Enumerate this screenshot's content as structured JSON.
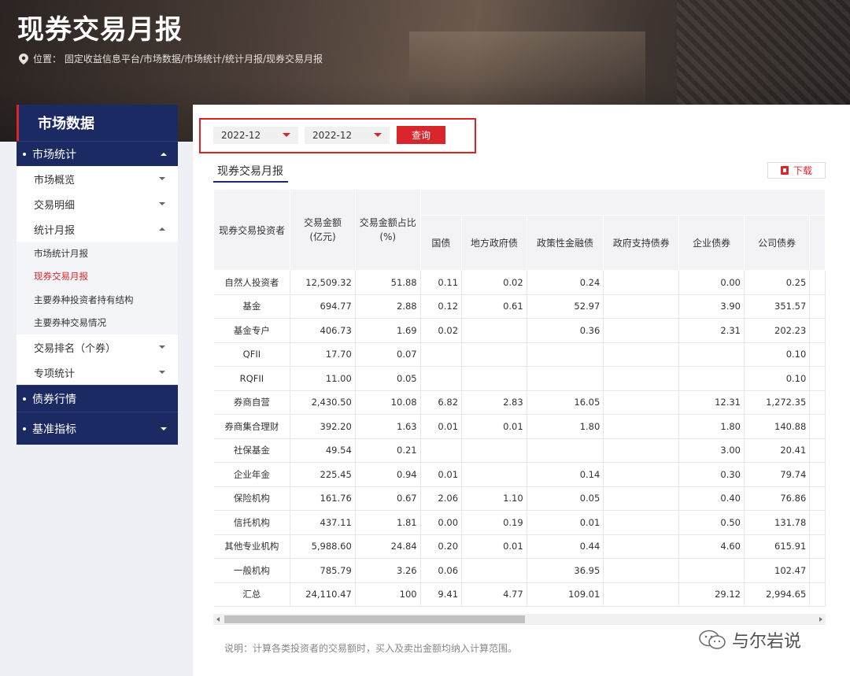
{
  "page": {
    "title": "现券交易月报",
    "breadcrumb": "位置： 固定收益信息平台/市场数据/市场统计/统计月报/现券交易月报"
  },
  "sidebar": {
    "header": "市场数据",
    "group_market_stats": "市场统计",
    "items": {
      "overview": "市场概览",
      "detail": "交易明细",
      "monthly": "统计月报",
      "leaf1": "市场统计月报",
      "leaf2": "现券交易月报",
      "leaf3": "主要券种投资者持有结构",
      "leaf4": "主要券种交易情况",
      "ranking": "交易排名（个券）",
      "special": "专项统计"
    },
    "group_bond_quotes": "债券行情",
    "group_benchmark": "基准指标"
  },
  "filter": {
    "start_month": "2022-12",
    "end_month": "2022-12",
    "query_label": "查询"
  },
  "report": {
    "title": "现券交易月报",
    "download_label": "下载"
  },
  "table": {
    "headers": {
      "investor": "现券交易投资者",
      "amount": "交易金额\n(亿元)",
      "ratio": "交易金额占比\n(%)",
      "cols": [
        "国债",
        "地方政府债",
        "政策性金融债",
        "政府支持债券",
        "企业债券",
        "公司债券"
      ]
    },
    "rows": [
      [
        "自然人投资者",
        "12,509.32",
        "51.88",
        "0.11",
        "0.02",
        "0.24",
        "",
        "0.00",
        "0.25"
      ],
      [
        "基金",
        "694.77",
        "2.88",
        "0.12",
        "0.61",
        "52.97",
        "",
        "3.90",
        "351.57"
      ],
      [
        "基金专户",
        "406.73",
        "1.69",
        "0.02",
        "",
        "0.36",
        "",
        "2.31",
        "202.23"
      ],
      [
        "QFII",
        "17.70",
        "0.07",
        "",
        "",
        "",
        "",
        "",
        "0.10"
      ],
      [
        "RQFII",
        "11.00",
        "0.05",
        "",
        "",
        "",
        "",
        "",
        "0.10"
      ],
      [
        "券商自营",
        "2,430.50",
        "10.08",
        "6.82",
        "2.83",
        "16.05",
        "",
        "12.31",
        "1,272.35"
      ],
      [
        "券商集合理财",
        "392.20",
        "1.63",
        "0.01",
        "0.01",
        "1.80",
        "",
        "1.80",
        "140.88"
      ],
      [
        "社保基金",
        "49.54",
        "0.21",
        "",
        "",
        "",
        "",
        "3.00",
        "20.41"
      ],
      [
        "企业年金",
        "225.45",
        "0.94",
        "0.01",
        "",
        "0.14",
        "",
        "0.30",
        "79.74"
      ],
      [
        "保险机构",
        "161.76",
        "0.67",
        "2.06",
        "1.10",
        "0.05",
        "",
        "0.40",
        "76.86"
      ],
      [
        "信托机构",
        "437.11",
        "1.81",
        "0.00",
        "0.19",
        "0.01",
        "",
        "0.50",
        "131.78"
      ],
      [
        "其他专业机构",
        "5,988.60",
        "24.84",
        "0.20",
        "0.01",
        "0.44",
        "",
        "4.60",
        "615.91"
      ],
      [
        "一般机构",
        "785.79",
        "3.26",
        "0.06",
        "",
        "36.95",
        "",
        "",
        "102.47"
      ],
      [
        "汇总",
        "24,110.47",
        "100",
        "9.41",
        "4.77",
        "109.01",
        "",
        "29.12",
        "2,994.65"
      ]
    ]
  },
  "note": "说明：计算各类投资者的交易额时，买入及卖出金额均纳入计算范围。",
  "watermark": "与尔岩说",
  "colors": {
    "brand_red": "#d9262c",
    "navy": "#1c2a64"
  }
}
